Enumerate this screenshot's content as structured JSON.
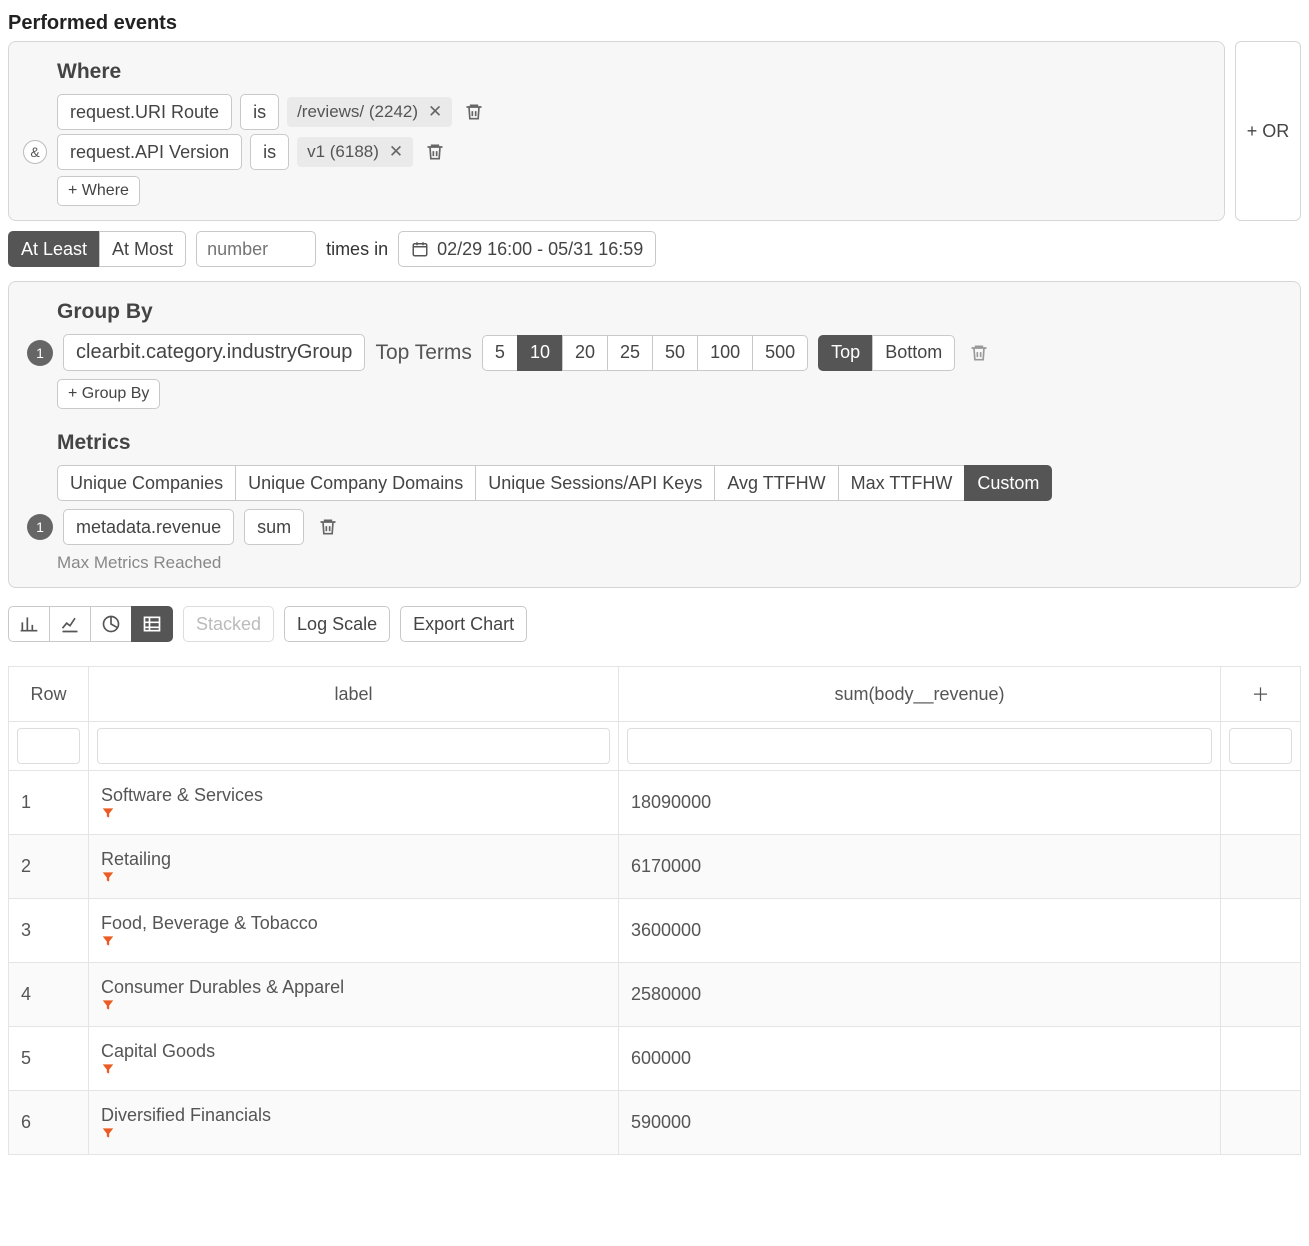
{
  "title": "Performed events",
  "where": {
    "heading": "Where",
    "rows": [
      {
        "field": "request.URI Route",
        "op": "is",
        "chip": "/reviews/ (2242)"
      },
      {
        "field": "request.API Version",
        "op": "is",
        "chip": "v1 (6188)"
      }
    ],
    "add": "+ Where",
    "or": "+ OR",
    "and": "&"
  },
  "freq": {
    "at_least": "At Least",
    "at_most": "At Most",
    "placeholder": "number",
    "times_in": "times in",
    "range": "02/29 16:00 - 05/31 16:59"
  },
  "group": {
    "heading": "Group By",
    "badge": "1",
    "field": "clearbit.category.industryGroup",
    "top_terms": "Top Terms",
    "sizes": [
      "5",
      "10",
      "20",
      "25",
      "50",
      "100",
      "500"
    ],
    "size_selected": "10",
    "top": "Top",
    "bottom": "Bottom",
    "add": "+ Group By"
  },
  "metrics": {
    "heading": "Metrics",
    "options": [
      "Unique Companies",
      "Unique Company Domains",
      "Unique Sessions/API Keys",
      "Avg TTFHW",
      "Max TTFHW",
      "Custom"
    ],
    "selected": "Custom",
    "badge": "1",
    "field": "metadata.revenue",
    "agg": "sum",
    "note": "Max Metrics Reached"
  },
  "toolbar": {
    "stacked": "Stacked",
    "log": "Log Scale",
    "export": "Export Chart"
  },
  "table": {
    "headers": {
      "row": "Row",
      "label": "label",
      "value": "sum(body__revenue)"
    },
    "rows": [
      {
        "n": "1",
        "label": "Software & Services",
        "value": "18090000"
      },
      {
        "n": "2",
        "label": "Retailing",
        "value": "6170000"
      },
      {
        "n": "3",
        "label": "Food, Beverage & Tobacco",
        "value": "3600000"
      },
      {
        "n": "4",
        "label": "Consumer Durables & Apparel",
        "value": "2580000"
      },
      {
        "n": "5",
        "label": "Capital Goods",
        "value": "600000"
      },
      {
        "n": "6",
        "label": "Diversified Financials",
        "value": "590000"
      }
    ]
  }
}
